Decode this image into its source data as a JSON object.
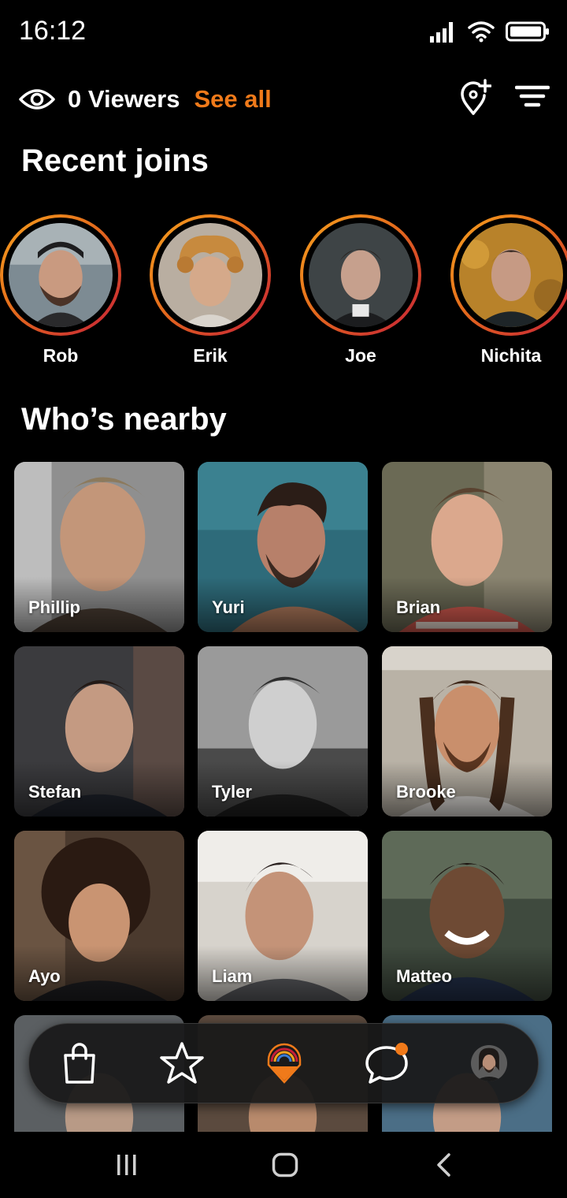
{
  "status_bar": {
    "time": "16:12"
  },
  "header": {
    "viewers_label": "0 Viewers",
    "see_all_label": "See all"
  },
  "recent_joins": {
    "title": "Recent joins",
    "people": [
      {
        "name": "Rob"
      },
      {
        "name": "Erik"
      },
      {
        "name": "Joe"
      },
      {
        "name": "Nichita"
      }
    ]
  },
  "nearby": {
    "title": "Who’s nearby",
    "people": [
      {
        "name": "Phillip"
      },
      {
        "name": "Yuri"
      },
      {
        "name": "Brian"
      },
      {
        "name": "Stefan"
      },
      {
        "name": "Tyler"
      },
      {
        "name": "Brooke"
      },
      {
        "name": "Ayo"
      },
      {
        "name": "Liam"
      },
      {
        "name": "Matteo"
      },
      {
        "name": ""
      },
      {
        "name": ""
      },
      {
        "name": ""
      }
    ]
  },
  "bottom_nav": {
    "items": [
      {
        "icon": "shopping-bag-icon"
      },
      {
        "icon": "star-icon"
      },
      {
        "icon": "app-logo-icon"
      },
      {
        "icon": "chat-bubble-icon",
        "has_notification": true
      },
      {
        "icon": "profile-avatar"
      }
    ]
  },
  "colors": {
    "accent": "#F07A1A",
    "ring_start": "#F6A21E",
    "ring_end": "#C51E38",
    "background": "#000000"
  }
}
